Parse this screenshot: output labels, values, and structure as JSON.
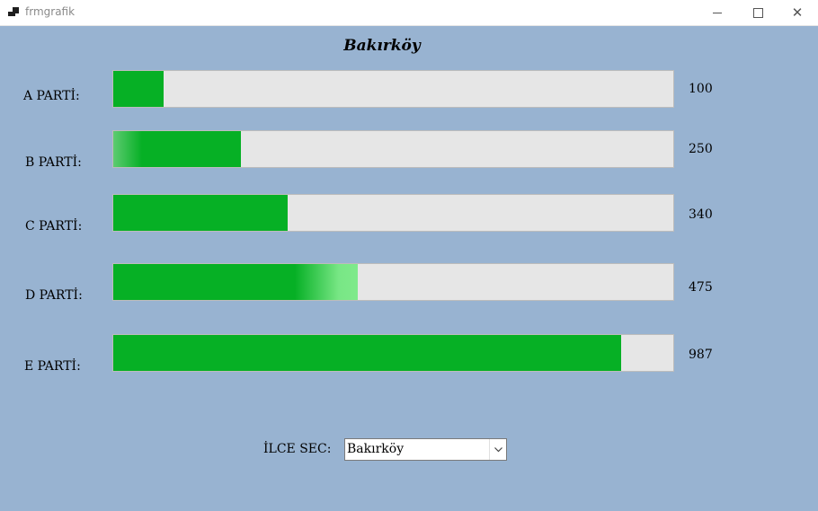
{
  "window": {
    "title": "frmgrafik"
  },
  "district_title": "Bakırköy",
  "parties": [
    {
      "label": "A PARTİ:",
      "value": "100",
      "level": 0.09
    },
    {
      "label": "B PARTİ:",
      "value": "250",
      "level": 0.228
    },
    {
      "label": "C PARTİ:",
      "value": "340",
      "level": 0.311
    },
    {
      "label": "D PARTİ:",
      "value": "475",
      "level": 0.436
    },
    {
      "label": "E PARTİ:",
      "value": "987",
      "level": 0.907
    }
  ],
  "ilce": {
    "label": "İLCE SEC:",
    "selected": "Bakırköy"
  },
  "colors": {
    "background": "#98b3d1",
    "bar_fill": "#06b025",
    "bar_track": "#e6e6e6"
  },
  "icons": {
    "minimize": "minimize-icon",
    "maximize": "maximize-icon",
    "close": "close-icon",
    "dropdown": "chevron-down-icon"
  }
}
